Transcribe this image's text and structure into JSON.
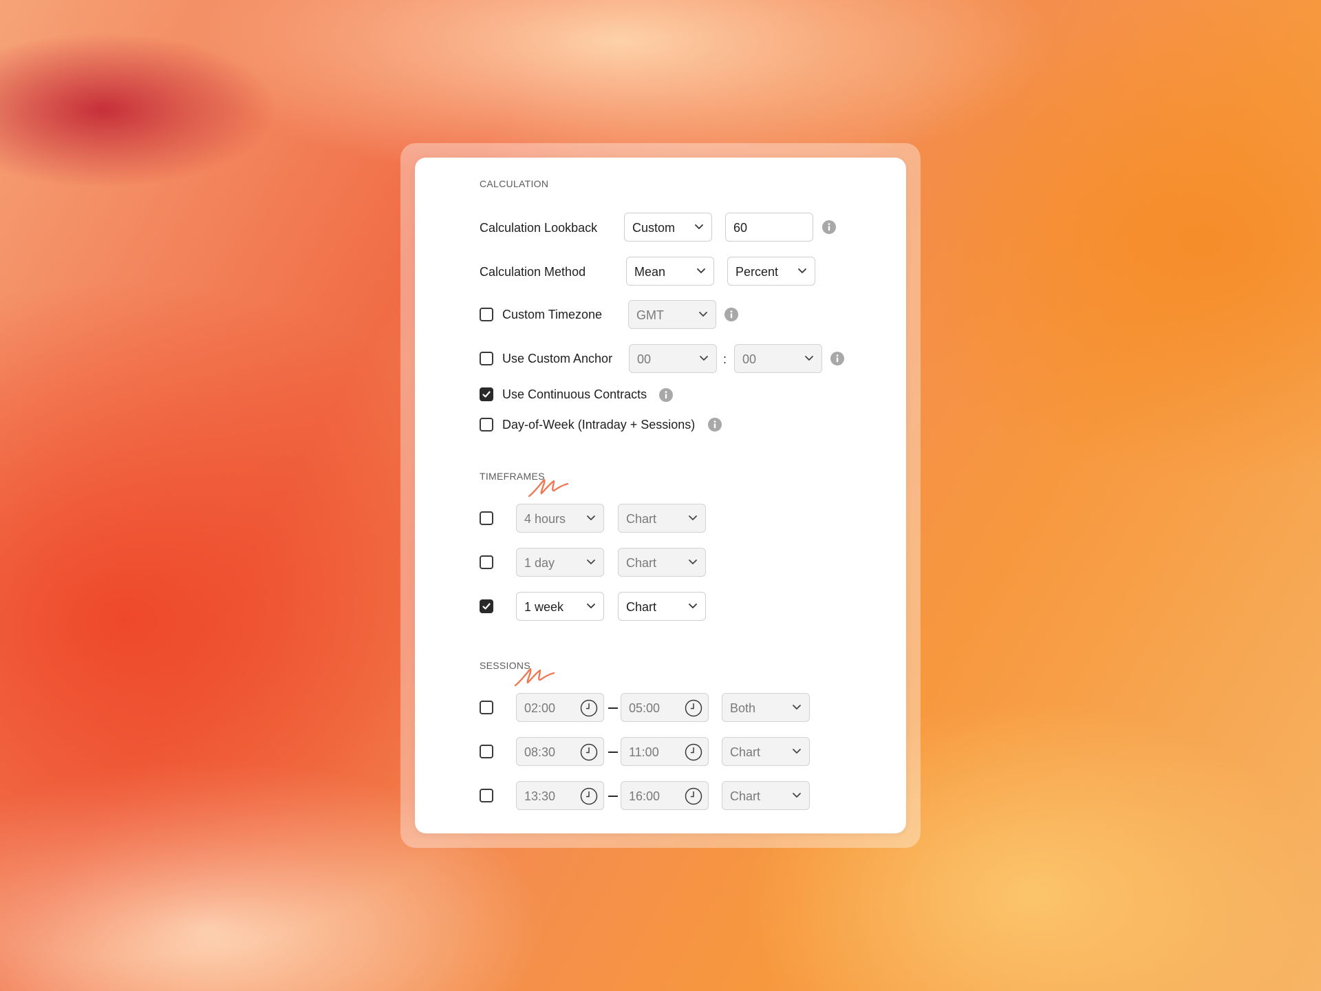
{
  "calculation": {
    "title": "CALCULATION",
    "lookback": {
      "label": "Calculation Lookback",
      "mode": "Custom",
      "value": "60"
    },
    "method": {
      "label": "Calculation Method",
      "stat": "Mean",
      "unit": "Percent"
    },
    "timezone": {
      "label": "Custom Timezone",
      "checked": false,
      "value": "GMT"
    },
    "anchor": {
      "label": "Use Custom Anchor",
      "checked": false,
      "hour": "00",
      "separator": ":",
      "minute": "00"
    },
    "continuous": {
      "label": "Use Continuous Contracts",
      "checked": true
    },
    "day_of_week": {
      "label": "Day-of-Week (Intraday + Sessions)",
      "checked": false
    }
  },
  "timeframes": {
    "title": "TIMEFRAMES",
    "rows": [
      {
        "checked": false,
        "period": "4 hours",
        "display": "Chart"
      },
      {
        "checked": false,
        "period": "1 day",
        "display": "Chart"
      },
      {
        "checked": true,
        "period": "1 week",
        "display": "Chart"
      }
    ]
  },
  "sessions": {
    "title": "SESSIONS",
    "rows": [
      {
        "checked": false,
        "start": "02:00",
        "end": "05:00",
        "display": "Both"
      },
      {
        "checked": false,
        "start": "08:30",
        "end": "11:00",
        "display": "Chart"
      },
      {
        "checked": false,
        "start": "13:30",
        "end": "16:00",
        "display": "Chart"
      }
    ]
  },
  "colors": {
    "accent_scribble": "#ee7a55",
    "checkbox_checked": "#2a2a2a",
    "info_icon": "#a8a8a8"
  },
  "icons": {
    "chevron": "chevron-down-icon",
    "info": "info-icon",
    "clock": "clock-icon",
    "check": "check-icon"
  }
}
